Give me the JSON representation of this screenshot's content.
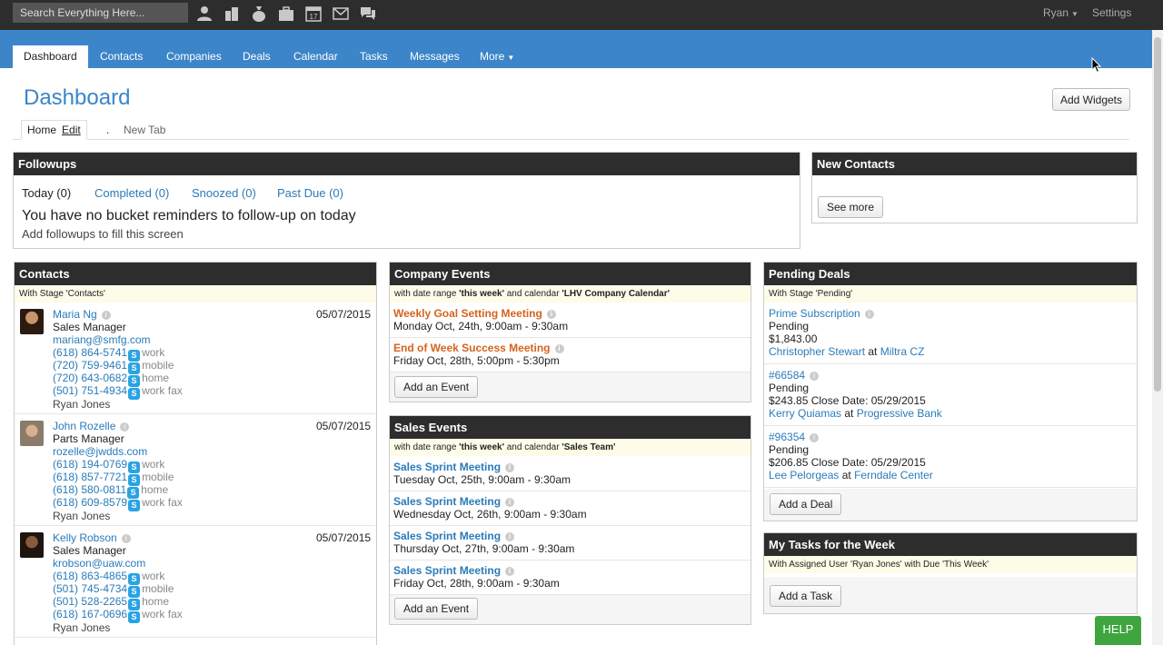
{
  "topbar": {
    "search_placeholder": "Search Everything Here...",
    "icons": [
      "person-icon",
      "building-icon",
      "money-bag-icon",
      "briefcase-icon",
      "calendar-icon",
      "envelope-icon",
      "chat-icon"
    ],
    "calendar_icon_day": "17",
    "user_name": "Ryan",
    "settings_label": "Settings"
  },
  "nav": {
    "tabs": [
      {
        "label": "Dashboard"
      },
      {
        "label": "Contacts"
      },
      {
        "label": "Companies"
      },
      {
        "label": "Deals"
      },
      {
        "label": "Calendar"
      },
      {
        "label": "Tasks"
      },
      {
        "label": "Messages"
      },
      {
        "label": "More"
      }
    ]
  },
  "page": {
    "title": "Dashboard",
    "add_widgets_label": "Add Widgets",
    "tabs": {
      "home": "Home",
      "edit": "Edit",
      "dot": ".",
      "new_tab": "New Tab"
    }
  },
  "followups": {
    "title": "Followups",
    "tabs": [
      "Today (0)",
      "Completed (0)",
      "Snoozed (0)",
      "Past Due (0)"
    ],
    "message": "You have no bucket reminders to follow-up on today",
    "hint": "Add followups to fill this screen"
  },
  "new_contacts": {
    "title": "New Contacts",
    "see_more_label": "See more"
  },
  "contacts": {
    "title": "Contacts",
    "subtitle": "With Stage 'Contacts'",
    "items": [
      {
        "name": "Maria Ng",
        "date": "05/07/2015",
        "role": "Sales Manager",
        "email": "mariang@smfg.com",
        "phones": [
          {
            "number": "(618) 864-5741",
            "type": "work"
          },
          {
            "number": "(720) 759-9461",
            "type": "mobile"
          },
          {
            "number": "(720) 643-0682",
            "type": "home"
          },
          {
            "number": "(501) 751-4934",
            "type": "work fax"
          }
        ],
        "owner": "Ryan Jones"
      },
      {
        "name": "John Rozelle",
        "date": "05/07/2015",
        "role": "Parts Manager",
        "email": "rozelle@jwdds.com",
        "phones": [
          {
            "number": "(618) 194-0769",
            "type": "work"
          },
          {
            "number": "(618) 857-7721",
            "type": "mobile"
          },
          {
            "number": "(618) 580-0811",
            "type": "home"
          },
          {
            "number": "(618) 609-8579",
            "type": "work fax"
          }
        ],
        "owner": "Ryan Jones"
      },
      {
        "name": "Kelly Robson",
        "date": "05/07/2015",
        "role": "Sales Manager",
        "email": "krobson@uaw.com",
        "phones": [
          {
            "number": "(618) 863-4865",
            "type": "work"
          },
          {
            "number": "(501) 745-4734",
            "type": "mobile"
          },
          {
            "number": "(501) 528-2265",
            "type": "home"
          },
          {
            "number": "(618) 167-0696",
            "type": "work fax"
          }
        ],
        "owner": "Ryan Jones"
      }
    ],
    "skype_letter": "S"
  },
  "company_events": {
    "title": "Company Events",
    "subtitle_pre": "with date range ",
    "subtitle_range": "'this week'",
    "subtitle_mid": " and calendar ",
    "subtitle_calendar": "'LHV Company Calendar'",
    "items": [
      {
        "title": "Weekly Goal Setting Meeting",
        "time": "Monday Oct, 24th, 9:00am - 9:30am"
      },
      {
        "title": "End of Week Success Meeting",
        "time": "Friday Oct, 28th, 5:00pm - 5:30pm"
      }
    ],
    "add_label": "Add an Event"
  },
  "sales_events": {
    "title": "Sales Events",
    "subtitle_pre": "with date range ",
    "subtitle_range": "'this week'",
    "subtitle_mid": " and calendar ",
    "subtitle_calendar": "'Sales Team'",
    "items": [
      {
        "title": "Sales Sprint Meeting",
        "time": "Tuesday Oct, 25th, 9:00am - 9:30am"
      },
      {
        "title": "Sales Sprint Meeting",
        "time": "Wednesday Oct, 26th, 9:00am - 9:30am"
      },
      {
        "title": "Sales Sprint Meeting",
        "time": "Thursday Oct, 27th, 9:00am - 9:30am"
      },
      {
        "title": "Sales Sprint Meeting",
        "time": "Friday Oct, 28th, 9:00am - 9:30am"
      }
    ],
    "add_label": "Add an Event"
  },
  "pending_deals": {
    "title": "Pending Deals",
    "subtitle": "With Stage 'Pending'",
    "items": [
      {
        "name": "Prime Subscription",
        "status": "Pending",
        "amount": "$1,843.00",
        "contact": "Christopher Stewart",
        "at": " at ",
        "company": "Miltra CZ"
      },
      {
        "name": "#66584",
        "status": "Pending",
        "amount": "$243.85 Close Date: 05/29/2015",
        "contact": "Kerry Quiamas",
        "at": " at ",
        "company": "Progressive Bank"
      },
      {
        "name": "#96354",
        "status": "Pending",
        "amount": "$206.85 Close Date: 05/29/2015",
        "contact": "Lee Pelorgeas",
        "at": " at ",
        "company": "Ferndale Center"
      }
    ],
    "add_label": "Add a Deal"
  },
  "tasks": {
    "title": "My Tasks for the Week",
    "subtitle": "With Assigned User 'Ryan Jones' with Due 'This Week'",
    "add_label": "Add a Task"
  },
  "help_label": "HELP",
  "colors": {
    "topbar": "#2d2d2d",
    "nav": "#3c85c9",
    "link": "#2a7bb9",
    "event_orange": "#d5631c",
    "help_green": "#3fa63f"
  }
}
